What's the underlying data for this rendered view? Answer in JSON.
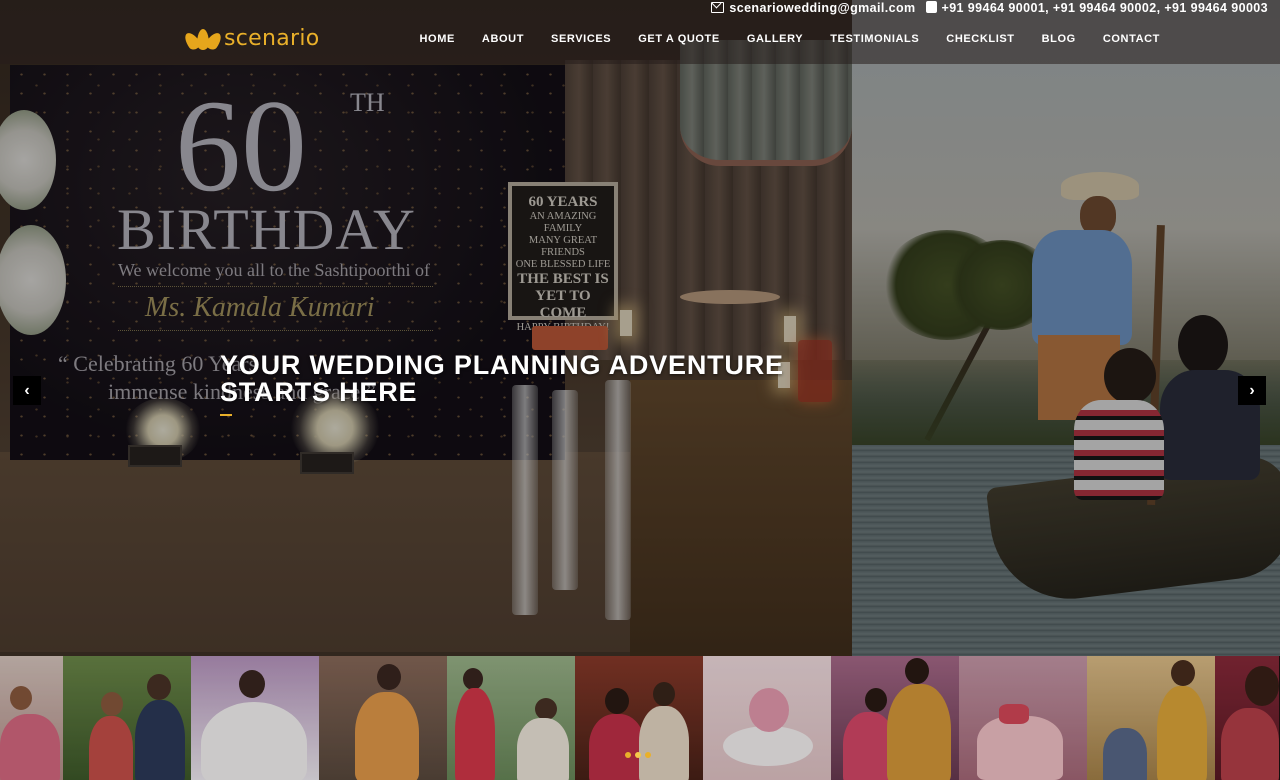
{
  "topbar": {
    "email": "scenariowedding@gmail.com",
    "phones": "+91 99464 90001,  +91 99464 90002,  +91 99464 90003"
  },
  "brand": {
    "name": "scenario",
    "color": "#e9b02a"
  },
  "nav": {
    "items": [
      "HOME",
      "ABOUT",
      "SERVICES",
      "GET A QUOTE",
      "GALLERY",
      "TESTIMONIALS",
      "CHECKLIST",
      "BLOG",
      "CONTACT"
    ]
  },
  "hero": {
    "headline": "YOUR WEDDING PLANNING ADVENTURE STARTS HERE",
    "prev_icon": "chevron-left",
    "next_icon": "chevron-right",
    "backdrop": {
      "number": "60",
      "suffix": "TH",
      "title": "BIRTHDAY",
      "welcome": "We welcome you all to the Sashtipoorthi of",
      "name": "Ms. Kamala Kumari",
      "quote_line1": "“ Celebrating 60 Years",
      "quote_line2": "immense kindness and grace ”"
    },
    "board": {
      "line1": "60 YEARS",
      "line2": "AN AMAZING FAMILY",
      "line3": "MANY GREAT FRIENDS",
      "line4": "ONE BLESSED LIFE",
      "line5": "THE BEST IS",
      "line6": "YET TO COME",
      "line7": "HAPPY BIRTHDAY!"
    }
  },
  "slider": {
    "dot_count": 3,
    "active_index": 1
  }
}
